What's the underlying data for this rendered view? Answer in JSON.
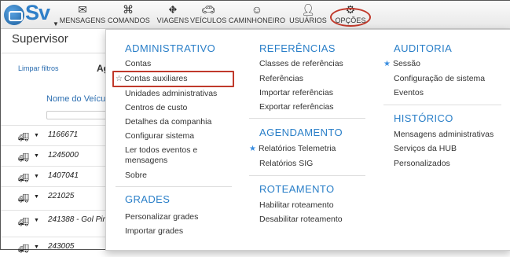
{
  "nav": {
    "logo_text": "Sv",
    "items": [
      {
        "label": "MENSAGENS",
        "icon": "envelope-icon"
      },
      {
        "label": "COMANDOS",
        "icon": "command-icon"
      },
      {
        "label": "VIAGENS",
        "icon": "road-icon"
      },
      {
        "label": "VEÍCULOS",
        "icon": "car-icon"
      },
      {
        "label": "CAMINHONEIRO",
        "icon": "trucker-icon"
      },
      {
        "label": "USUÁRIOS",
        "icon": "user-icon"
      },
      {
        "label": "OPÇÕES",
        "icon": "gears-icon"
      }
    ],
    "highlight_color": "#c0392b"
  },
  "page": {
    "title": "Supervisor",
    "clear_filters": "Limpar filtros",
    "fragment": "Ag",
    "column_header": "Nome do Veículo",
    "rows": [
      "1166671",
      "1245000",
      "1407041",
      "221025",
      "241388 - Gol Pir",
      "243005"
    ]
  },
  "menu": {
    "col1": {
      "heading": "ADMINISTRATIVO",
      "items": [
        "Contas",
        "Contas auxiliares",
        "Unidades administrativas",
        "Centros de custo",
        "Detalhes da companhia",
        "Configurar sistema",
        "Ler todos eventos e mensagens",
        "Sobre"
      ],
      "heading2": "GRADES",
      "items2": [
        "Personalizar grades",
        "Importar grades"
      ]
    },
    "col2": {
      "heading": "REFERÊNCIAS",
      "items": [
        "Classes de referências",
        "Referências",
        "Importar referências",
        "Exportar referências"
      ],
      "heading2": "AGENDAMENTO",
      "items2": [
        "Relatórios Telemetria",
        "Relatórios SIG"
      ],
      "heading3": "ROTEAMENTO",
      "items3": [
        "Habilitar roteamento",
        "Desabilitar roteamento"
      ]
    },
    "col3": {
      "heading": "AUDITORIA",
      "items": [
        "Sessão",
        "Configuração de sistema",
        "Eventos"
      ],
      "heading2": "HISTÓRICO",
      "items2": [
        "Mensagens administrativas",
        "Serviços da HUB",
        "Personalizados"
      ]
    },
    "accent_color": "#2a7fc8"
  }
}
